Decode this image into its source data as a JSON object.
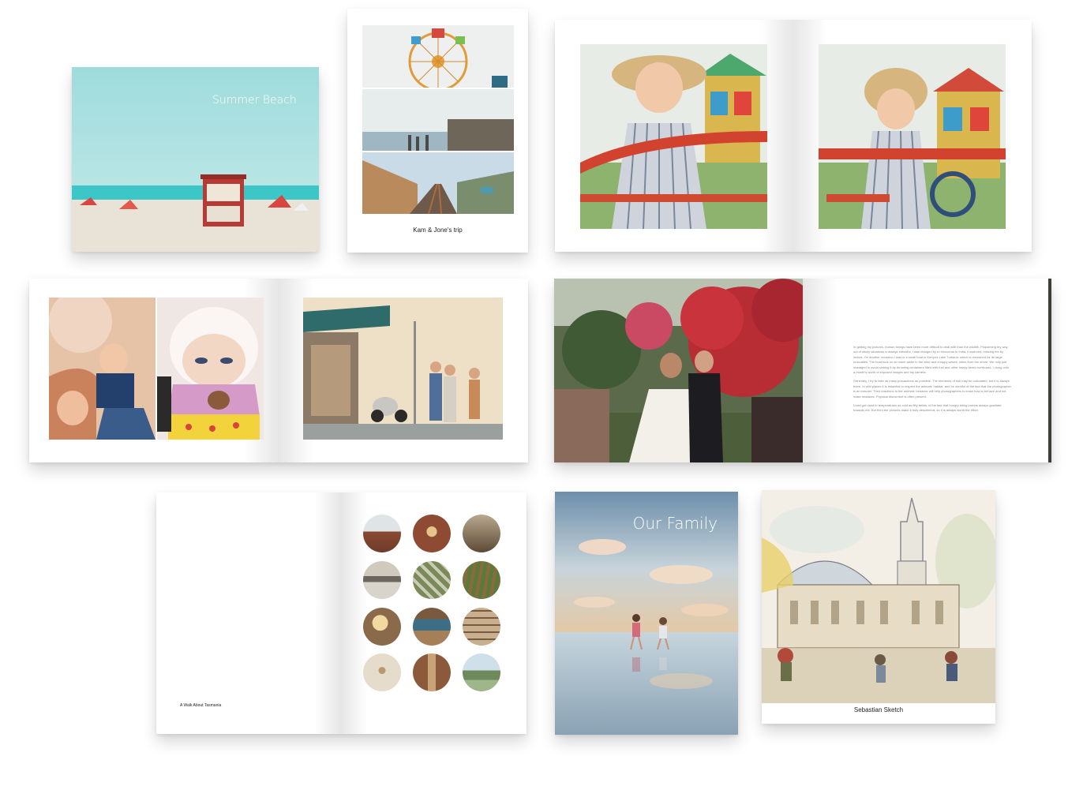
{
  "books": {
    "summer_beach": {
      "cover_title": "Summer Beach"
    },
    "trip": {
      "caption": "Kam & Jone's trip"
    },
    "wedding": {
      "paragraphs": [
        "In getting my pictures, human beings have been more difficult to deal with than the wildlife. Pinpointing my way out of sticky situations is always stressful, I was charged by a rhinoceros in India, it swerved, missing me by inches. On another occasion I was in a small boat in Kenya's Lake Turkana, which is renowned for its large crocodiles. The boat took on so much water in the wind and choppy waves, miles from the shore. We only just managed to avoid sinking it by throwing containers filled with fuel and other heavy items overboard, I clung onto a month's worth of exposed images and my camera.",
        "Generally, I try to take as many precautions as possible. The elements of risk may be calculated, but it is always there. In wild places it is essential to respect the animals' habitat, and be mindful of the fact that the photographer is an intruder. Their reactions to the animals' behavior will help photographers to know how to behave and not make mistakes. Physical discomfort is often present.",
        "Lucid got used to temperatures as cold as fifty below, in the fact that hungry biting insects always gravitate towards me. But then the pictures make it truly descemfort, so it is always worth the effort."
      ]
    },
    "tasmania": {
      "caption": "A Walk About Tasmania"
    },
    "family": {
      "cover_title": "Our Family"
    },
    "sketch": {
      "caption": "Sebastian Sketch"
    }
  },
  "colors": {
    "background": "#ffffff",
    "page": "#ffffff",
    "sea": "#3fc7c9",
    "sky": "#a9dedf"
  }
}
